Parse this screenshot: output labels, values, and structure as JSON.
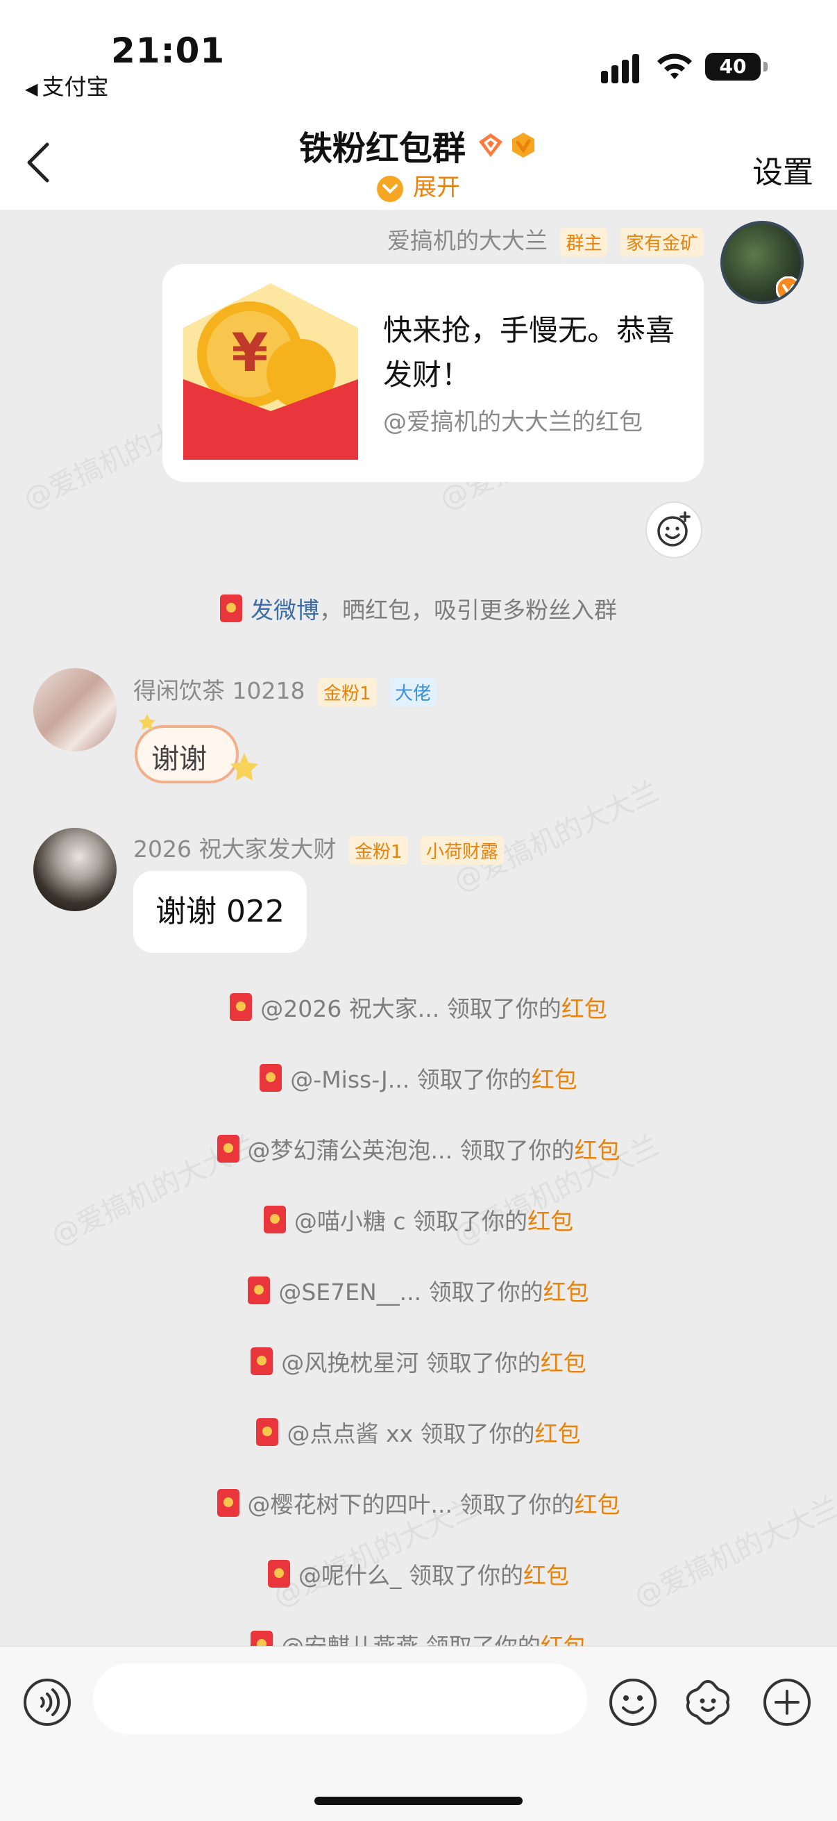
{
  "status_bar": {
    "time": "21:01",
    "back_app": "支付宝",
    "battery": "40"
  },
  "header": {
    "title": "铁粉红包群",
    "expand_label": "展开",
    "settings_label": "设置"
  },
  "red_packet_message": {
    "sender": "爱搞机的大大兰",
    "tags": [
      "群主",
      "家有金矿"
    ],
    "text": "快来抢，手慢无。恭喜发财！",
    "sub": "@爱搞机的大大兰的红包"
  },
  "share_tip": {
    "link": "发微博",
    "rest": "，晒红包，吸引更多粉丝入群"
  },
  "messages": [
    {
      "sender": "得闲饮茶 10218",
      "tags": [
        "金粉1",
        "大佬"
      ],
      "text": "谢谢"
    },
    {
      "sender": "2026 祝大家发大财",
      "tags": [
        "金粉1",
        "小荷财露"
      ],
      "text": "谢谢 022"
    }
  ],
  "claims": [
    {
      "who": "@2026 祝大家...",
      "mid": " 领取了你的",
      "hl": "红包"
    },
    {
      "who": "@-Miss-J...",
      "mid": " 领取了你的",
      "hl": "红包"
    },
    {
      "who": "@梦幻蒲公英泡泡...",
      "mid": " 领取了你的",
      "hl": "红包"
    },
    {
      "who": "@喵小糖 c",
      "mid": " 领取了你的",
      "hl": "红包"
    },
    {
      "who": "@SE7EN__...",
      "mid": " 领取了你的",
      "hl": "红包"
    },
    {
      "who": "@风挽枕星河",
      "mid": " 领取了你的",
      "hl": "红包"
    },
    {
      "who": "@点点酱 xx",
      "mid": " 领取了你的",
      "hl": "红包"
    },
    {
      "who": "@樱花树下的四叶...",
      "mid": " 领取了你的",
      "hl": "红包"
    },
    {
      "who": "@呢什么_",
      "mid": " 领取了你的",
      "hl": "红包"
    },
    {
      "who": "@安麒儿燕燕",
      "mid": " 领取了你的",
      "hl": "红包"
    }
  ],
  "watermark": "@爱搞机的大大兰",
  "colors": {
    "accent": "#e8820a",
    "link": "#3b6ea8",
    "red_packet": "#e8363c"
  },
  "icons": [
    "voice-icon",
    "emoji-icon",
    "sticker-icon",
    "plus-icon"
  ]
}
